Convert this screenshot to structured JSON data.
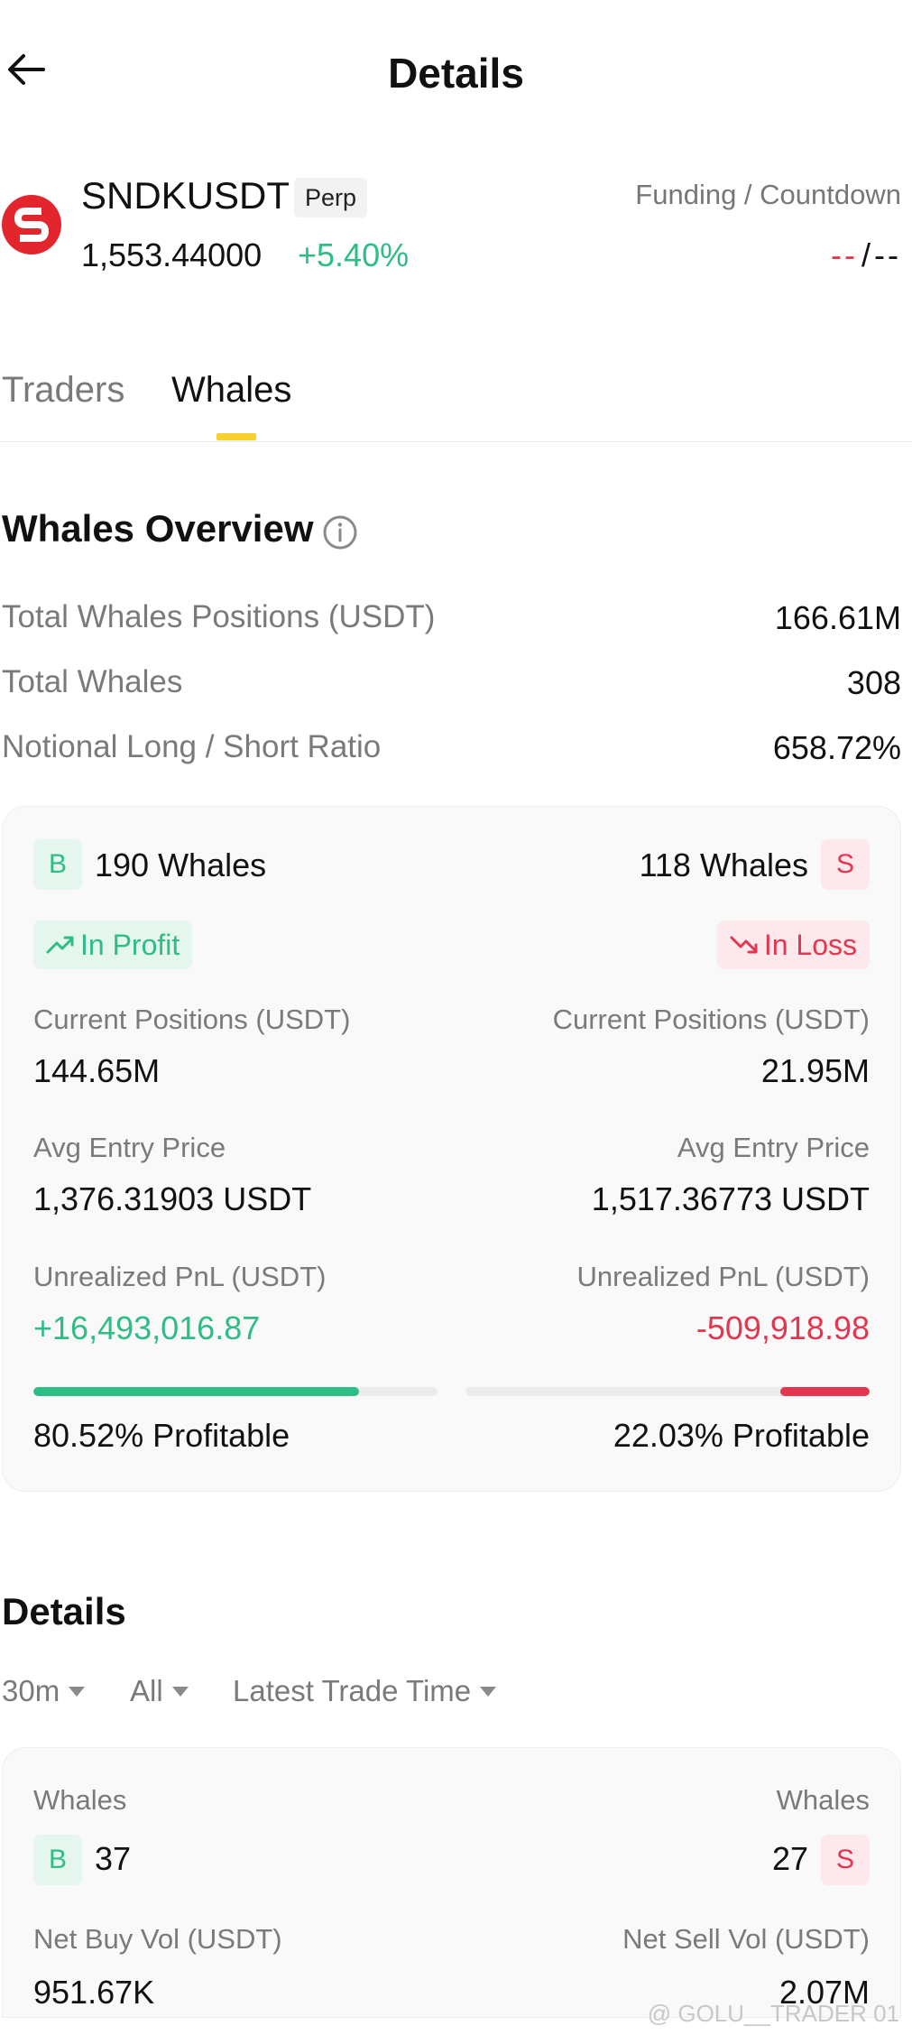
{
  "header": {
    "title": "Details"
  },
  "ticker": {
    "symbol": "SNDKUSDT",
    "contract_type": "Perp",
    "price": "1,553.44000",
    "change": "+5.40%",
    "funding_label": "Funding / Countdown",
    "funding_value": "--",
    "funding_sep": "/",
    "countdown_value": "--"
  },
  "tabs": [
    {
      "label": "Traders",
      "active": false
    },
    {
      "label": "Whales",
      "active": true
    }
  ],
  "overview": {
    "title": "Whales Overview",
    "rows": [
      {
        "label": "Total Whales Positions (USDT)",
        "value": "166.61M"
      },
      {
        "label": "Total Whales",
        "value": "308"
      },
      {
        "label": "Notional Long / Short Ratio",
        "value": "658.72%"
      }
    ]
  },
  "long_side": {
    "badge": "B",
    "whales": "190 Whales",
    "status": "In Profit",
    "positions_label": "Current Positions (USDT)",
    "positions_value": "144.65M",
    "entry_label": "Avg Entry Price",
    "entry_value": "1,376.31903 USDT",
    "pnl_label": "Unrealized PnL (USDT)",
    "pnl_value": "+16,493,016.87",
    "profitable_pct": 80.52,
    "profitable_text": "80.52% Profitable"
  },
  "short_side": {
    "badge": "S",
    "whales": "118 Whales",
    "status": "In Loss",
    "positions_label": "Current Positions (USDT)",
    "positions_value": "21.95M",
    "entry_label": "Avg Entry Price",
    "entry_value": "1,517.36773 USDT",
    "pnl_label": "Unrealized PnL (USDT)",
    "pnl_value": "-509,918.98",
    "profitable_pct": 22.03,
    "profitable_text": "22.03% Profitable"
  },
  "details": {
    "title": "Details",
    "filters": [
      "30m",
      "All",
      "Latest Trade Time"
    ],
    "buy": {
      "whales_label": "Whales",
      "badge": "B",
      "count": "37",
      "vol_label": "Net Buy Vol (USDT)",
      "vol_value": "951.67K"
    },
    "sell": {
      "whales_label": "Whales",
      "badge": "S",
      "count": "27",
      "vol_label": "Net Sell Vol (USDT)",
      "vol_value": "2.07M"
    }
  },
  "watermark": "@ GOLU__TRADER 01",
  "colors": {
    "green": "#2ebd85",
    "red": "#e3364f",
    "accent_yellow": "#f8d12f",
    "logo_red": "#e3262d"
  }
}
